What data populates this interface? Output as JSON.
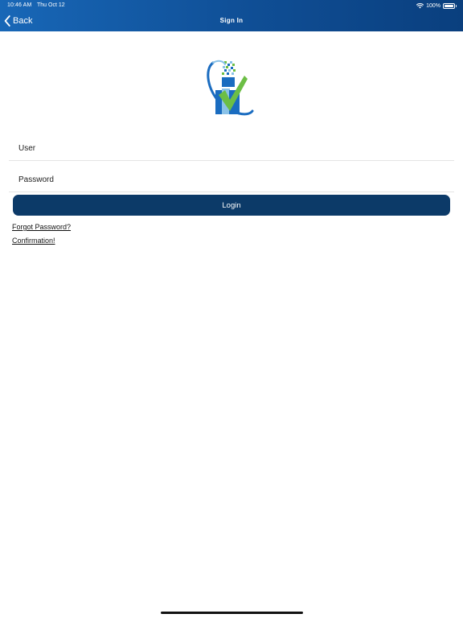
{
  "status_bar": {
    "time": "10:46 AM",
    "date": "Thu Oct 12",
    "battery": "100%",
    "wifi_icon": "wifi-icon",
    "battery_icon": "battery-icon"
  },
  "navbar": {
    "back_label": "Back",
    "back_icon": "chevron-left-icon",
    "title": "Sign In"
  },
  "form": {
    "user_placeholder": "User",
    "user_value": "",
    "password_placeholder": "Password",
    "password_value": "",
    "login_label": "Login"
  },
  "links": {
    "forgot_password": "Forgot Password?",
    "confirmation": "Confirmation!"
  },
  "colors": {
    "navbar_start": "#1867b7",
    "navbar_end": "#0a3f7e",
    "login_button": "#0c3a68",
    "logo_blue": "#1a6cc0",
    "logo_green": "#6cbe45"
  }
}
